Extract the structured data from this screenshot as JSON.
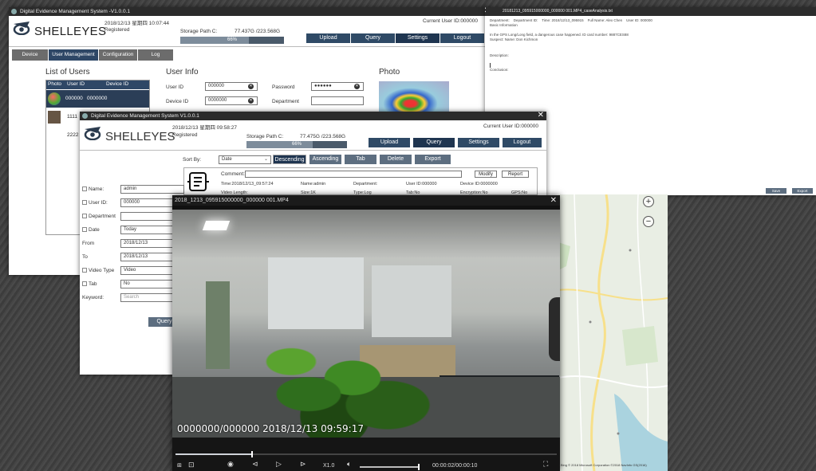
{
  "win_back": {
    "title": "Digital Evidence Management System  -V1.0.0.1",
    "datetime": "2018/12/13 星期四 10:07:44",
    "registered": "Registered",
    "brand": "SHELLEYES",
    "storage_label": "Storage Path C:",
    "storage_value": "77.437G /223.568G",
    "storage_pct": "66%",
    "storage_fraction": 0.66,
    "current_user": "Current User ID:000000",
    "top_buttons": [
      "Upload",
      "Query",
      "Settings",
      "Logout"
    ],
    "tabs": [
      "Device",
      "User Management",
      "Configuration",
      "Log"
    ],
    "list_title": "List of Users",
    "list_headers": [
      "Photo",
      "User ID",
      "Device ID"
    ],
    "list_rows": [
      {
        "user": "000000",
        "device": "0000000"
      },
      {
        "user": "1111",
        "device": ""
      },
      {
        "user": "2222",
        "device": ""
      }
    ],
    "info_title": "User Info",
    "info_labels": [
      "User ID",
      "Device ID"
    ],
    "info_values": [
      "000000",
      "0000000"
    ],
    "pwd_label": "Password",
    "pwd_value": "●●●●●●",
    "dept_label": "Department",
    "photo_title": "Photo"
  },
  "doc": {
    "title": "20181213_095915000000_000000 001.MP4_caseAnalysis.txt",
    "header": [
      "Department:",
      "Department ID:",
      "Time: 2018/12/13_095915",
      "Full Name: Alex Chen",
      "User ID: 000000"
    ],
    "line1": "Basic Information",
    "line2": "In the GPS Long/Long field, a dangerous case happened. ID card number: 9887CES88",
    "line3": "Suspect: Name: Don Kichmon",
    "desc": "Description:",
    "concl": "Conclusion:",
    "btn_save": "Save",
    "btn_export": "Export"
  },
  "win_front": {
    "title": "Digital Evidence Management System  V1.0.0.1",
    "datetime": "2018/12/13 星期四 09:58:27",
    "registered": "Registered",
    "brand": "SHELLEYES",
    "storage_label": "Storage Path C:",
    "storage_value": "77.475G /223.568G",
    "storage_pct": "66%",
    "storage_fraction": 0.66,
    "current_user": "Current User ID:000000",
    "top_buttons": [
      "Upload",
      "Query",
      "Settings",
      "Logout"
    ],
    "sort_label": "Sort By:",
    "sort_value": "Date",
    "sort_buttons": [
      "Descending",
      "Ascending",
      "Tab",
      "Delete",
      "Export"
    ],
    "comment_label": "Comment:",
    "modify": "Modify",
    "report": "Report",
    "rec_time": "Time:2018/12/13_09:57:24",
    "rec_name": "Name:admin",
    "rec_dept": "Department:",
    "rec_user": "User ID:000000",
    "rec_device": "Device ID:0000000",
    "rec_row2": [
      "Video Length:",
      "Size:1K",
      "Type:Log",
      "Tab:No",
      "Encryption:No",
      "GPS:No"
    ],
    "filters": [
      {
        "label": "Name:",
        "value": "admin"
      },
      {
        "label": "User ID:",
        "value": "000000"
      },
      {
        "label": "Department",
        "value": ""
      },
      {
        "label": "Date",
        "value": "Today"
      },
      {
        "label": "From",
        "value": "2018/12/13"
      },
      {
        "label": "To",
        "value": "2018/12/13"
      },
      {
        "label": "Video Type",
        "value": "Video"
      },
      {
        "label": "Tab",
        "value": "No"
      },
      {
        "label": "Keyword:",
        "value": "Search"
      }
    ],
    "query_btn": "Query"
  },
  "video": {
    "title": "2018_1213_095915000000_000000 001.MP4",
    "overlay": "0000000/000000  2018/12/13  09:59:17",
    "speed": "X1.0",
    "time": "00:00:02/00:00:10",
    "progress": 0.2,
    "volume": 1.0
  },
  "map": {
    "attribution": "Bing  © 2018 Microsoft Corporation  ©2018 NavInfo  GS(2016)"
  }
}
